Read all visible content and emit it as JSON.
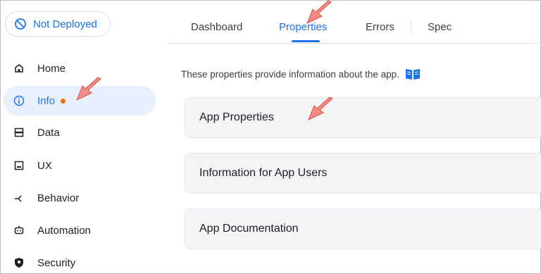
{
  "deploy_status": {
    "label": "Not Deployed",
    "icon": "not-deployed-icon"
  },
  "sidebar": {
    "items": [
      {
        "label": "Home",
        "icon": "home-icon"
      },
      {
        "label": "Info",
        "icon": "info-icon",
        "active": true,
        "has_dot": true
      },
      {
        "label": "Data",
        "icon": "data-icon"
      },
      {
        "label": "UX",
        "icon": "ux-icon"
      },
      {
        "label": "Behavior",
        "icon": "behavior-icon"
      },
      {
        "label": "Automation",
        "icon": "automation-icon"
      },
      {
        "label": "Security",
        "icon": "security-icon"
      }
    ]
  },
  "tabs": [
    {
      "label": "Dashboard"
    },
    {
      "label": "Properties",
      "active": true
    },
    {
      "label": "Errors"
    },
    {
      "label": "Spec"
    }
  ],
  "main": {
    "description": "These properties provide information about the app.",
    "doc_icon": "book-icon",
    "sections": [
      {
        "label": "App Properties"
      },
      {
        "label": "Information for App Users"
      },
      {
        "label": "App Documentation"
      }
    ]
  },
  "colors": {
    "accent": "#1a73e8",
    "active_bg": "#e8f0fe",
    "dot": "#e8710a",
    "card_bg": "#f3f4f6",
    "callout_arrow": "#f28b82"
  }
}
